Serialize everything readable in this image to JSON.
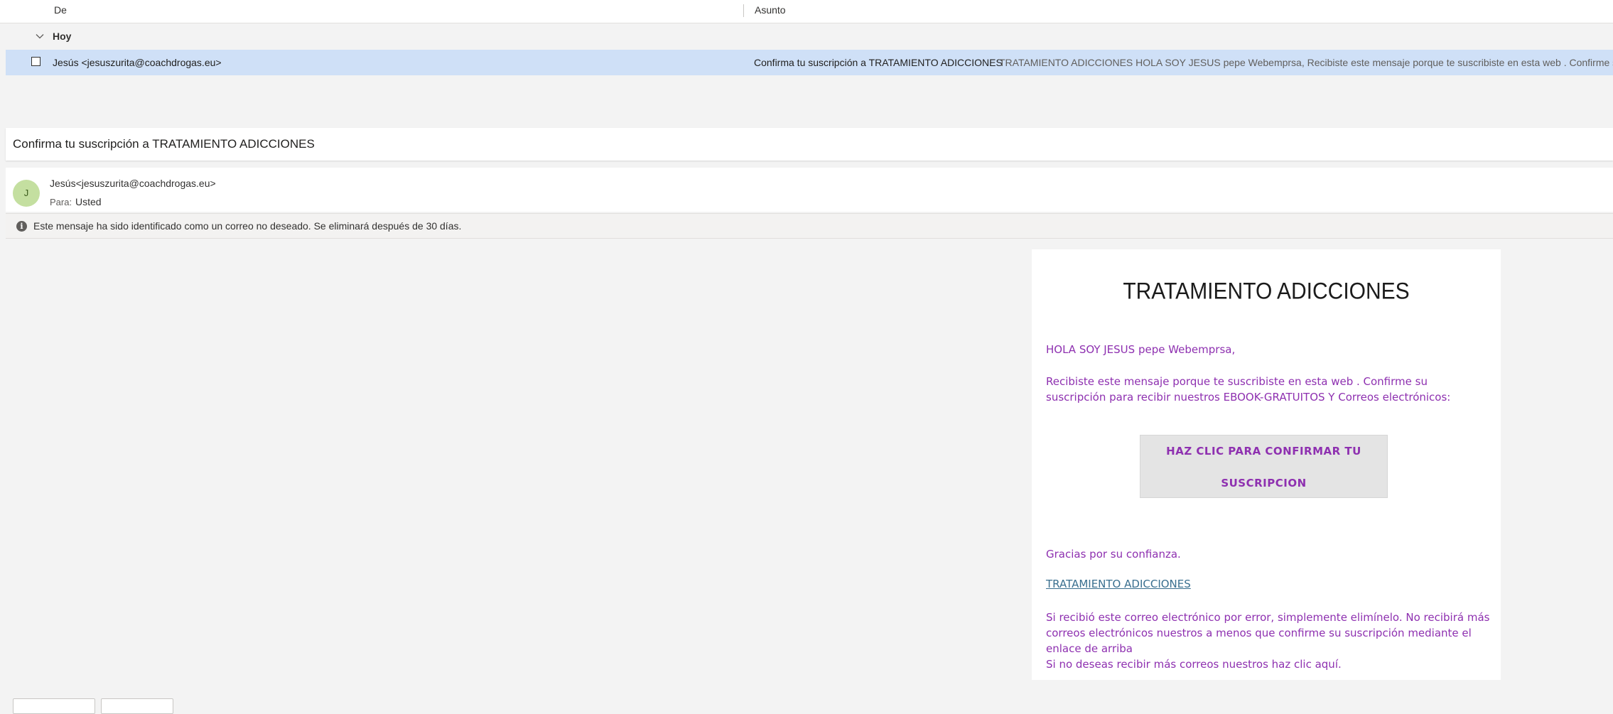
{
  "list": {
    "columns": {
      "from": "De",
      "subject": "Asunto"
    },
    "group": {
      "label": "Hoy"
    },
    "selected_message": {
      "from": "Jesús <jesuszurita@coachdrogas.eu>",
      "subject": "Confirma tu suscripción a TRATAMIENTO ADICCIONES",
      "preview": "TRATAMIENTO ADICCIONES HOLA SOY JESUS pepe Webemprsa, Recibiste este mensaje porque te suscribiste en esta web . Confirme su suscripción para recibir nuestros EBOOK-GRATUITOS"
    }
  },
  "reading_pane": {
    "subject": "Confirma tu suscripción a TRATAMIENTO ADICCIONES",
    "avatar_initial": "J",
    "sender": "Jesús<jesuszurita@coachdrogas.eu>",
    "to_label": "Para:",
    "to_value": "Usted",
    "info_icon": "i",
    "junk_notice": "Este mensaje ha sido identificado como un correo no deseado. Se eliminará después de 30 días."
  },
  "email": {
    "title": "TRATAMIENTO ADICCIONES",
    "greeting": "HOLA SOY JESUS pepe Webemprsa,",
    "intro": "Recibiste este mensaje porque te suscribiste en esta web . Confirme su suscripción para recibir nuestros EBOOK-GRATUITOS Y Correos electrónicos:",
    "cta_line1": "HAZ CLIC PARA CONFIRMAR TU",
    "cta_line2": "SUSCRIPCION",
    "thanks": "Gracias por su confianza.",
    "site_link": "TRATAMIENTO ADICCIONES",
    "footer": "Si recibió este correo electrónico por error, simplemente elimínelo. No recibirá más correos electrónicos nuestros a menos que confirme su suscripción mediante el enlace de arriba",
    "unsubscribe": "Si no deseas recibir más correos nuestros haz clic aquí."
  },
  "colors": {
    "selected_row": "#cfe0f7",
    "email_text_purple": "#8e30b0",
    "link": "#3a6f8f",
    "avatar_bg": "#c4dfa0"
  }
}
